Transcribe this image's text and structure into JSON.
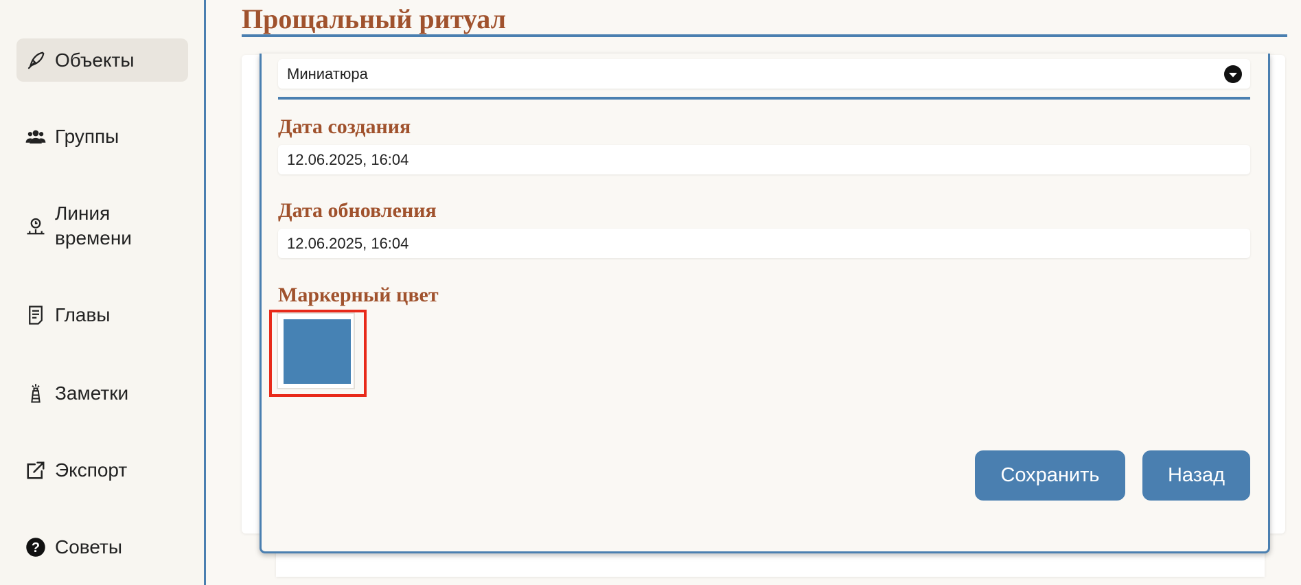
{
  "page": {
    "title": "Прощальный ритуал"
  },
  "sidebar": {
    "items": [
      {
        "label": "Объекты",
        "icon": "quill-icon",
        "active": true
      },
      {
        "label": "Группы",
        "icon": "users-icon",
        "active": false
      },
      {
        "label": "Линия\nвремени",
        "icon": "timeline-icon",
        "active": false
      },
      {
        "label": "Главы",
        "icon": "document-icon",
        "active": false
      },
      {
        "label": "Заметки",
        "icon": "lighthouse-icon",
        "active": false
      },
      {
        "label": "Экспорт",
        "icon": "external-link-icon",
        "active": false
      },
      {
        "label": "Советы",
        "icon": "question-circle-icon",
        "active": false
      }
    ]
  },
  "form": {
    "type_select": {
      "value": "Миниатюра"
    },
    "created": {
      "label": "Дата создания",
      "value": "12.06.2025, 16:04"
    },
    "updated": {
      "label": "Дата обновления",
      "value": "12.06.2025, 16:04"
    },
    "marker_color": {
      "label": "Маркерный цвет",
      "value": "#4682b4"
    },
    "save_label": "Сохранить",
    "back_label": "Назад"
  },
  "colors": {
    "accent": "#4a7fb0",
    "heading": "#a0522d",
    "highlight": "#e82a1a"
  }
}
